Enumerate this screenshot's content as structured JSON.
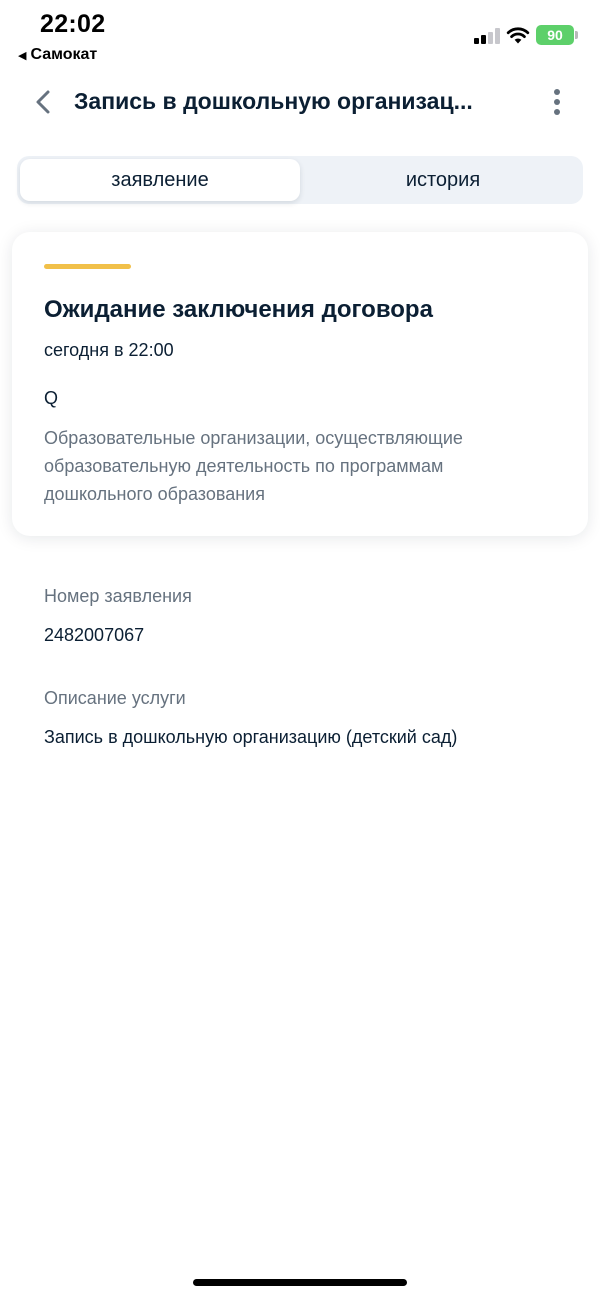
{
  "status_bar": {
    "time": "22:02",
    "back_app": "Самокат",
    "battery": "90"
  },
  "header": {
    "title": "Запись в дошкольную организац..."
  },
  "tabs": [
    {
      "label": "заявление",
      "active": true
    },
    {
      "label": "история",
      "active": false
    }
  ],
  "status_card": {
    "accent_color": "#f1c049",
    "title": "Ожидание заключения договора",
    "date": "сегодня в 22:00",
    "organization": "Q",
    "description": "Образовательные организации, осуществляющие образовательную деятельность по программам дошкольного образования"
  },
  "details": {
    "application_number_label": "Номер заявления",
    "application_number": "2482007067",
    "service_description_label": "Описание услуги",
    "service_description": "Запись в дошкольную организацию (детский сад)"
  }
}
